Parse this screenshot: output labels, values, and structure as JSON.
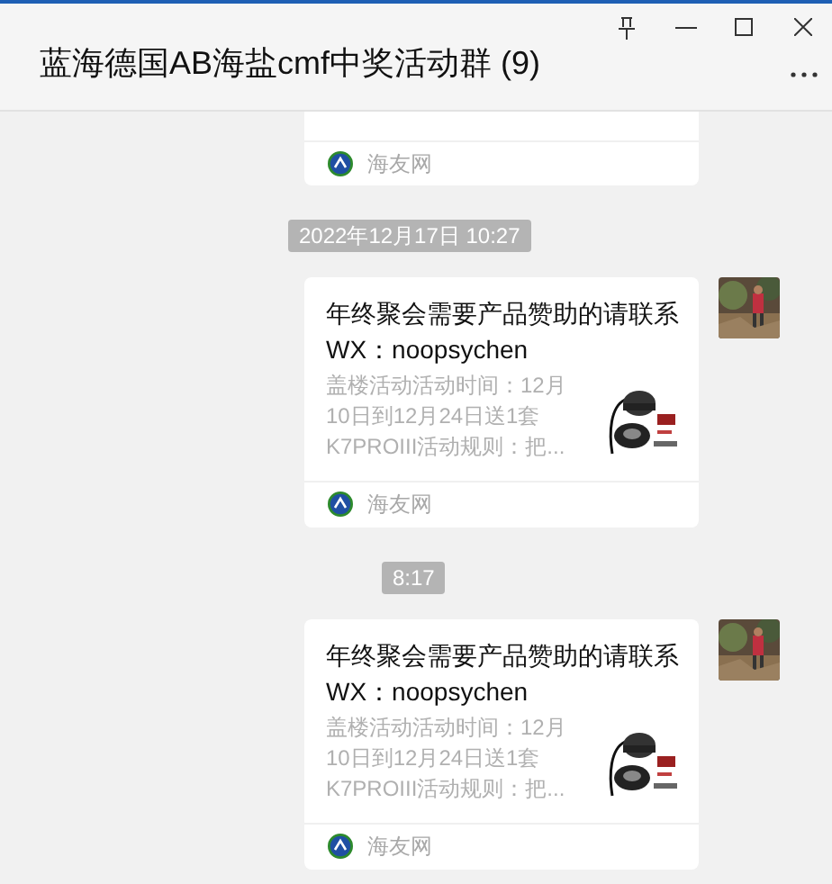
{
  "window": {
    "title": "蓝海德国AB海盐cmf中奖活动群 (9)"
  },
  "messages": [
    {
      "kind": "card_tail",
      "source": "海友网"
    },
    {
      "kind": "timestamp",
      "text": "2022年12月17日 10:27"
    },
    {
      "kind": "card",
      "title": "年终聚会需要产品赞助的请联系WX：noopsychen",
      "description": "盖楼活动活动时间：12月10日到12月24日送1套K7PROIII活动规则：把...",
      "source": "海友网"
    },
    {
      "kind": "timestamp",
      "text": "8:17"
    },
    {
      "kind": "card",
      "title": "年终聚会需要产品赞助的请联系WX：noopsychen",
      "description": "盖楼活动活动时间：12月10日到12月24日送1套K7PROIII活动规则：把...",
      "source": "海友网"
    }
  ]
}
